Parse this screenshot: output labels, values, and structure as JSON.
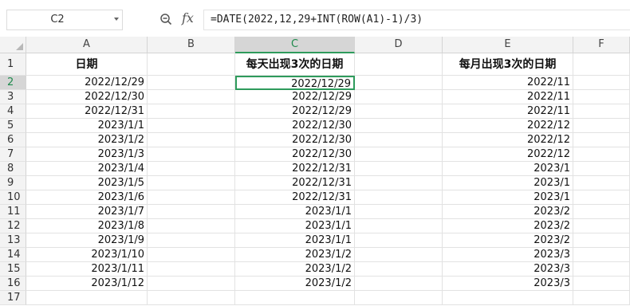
{
  "name_box": "C2",
  "formula": "=DATE(2022,12,29+INT(ROW(A1)-1)/3)",
  "columns": [
    "A",
    "B",
    "C",
    "D",
    "E",
    "F"
  ],
  "rows": [
    "1",
    "2",
    "3",
    "4",
    "5",
    "6",
    "7",
    "8",
    "9",
    "10",
    "11",
    "12",
    "13",
    "14",
    "15",
    "16",
    "17"
  ],
  "headers": {
    "A": "日期",
    "B": "",
    "C": "每天出现3次的日期",
    "D": "",
    "E": "每月出现3次的日期",
    "F": ""
  },
  "colA": [
    "2022/12/29",
    "2022/12/30",
    "2022/12/31",
    "2023/1/1",
    "2023/1/2",
    "2023/1/3",
    "2023/1/4",
    "2023/1/5",
    "2023/1/6",
    "2023/1/7",
    "2023/1/8",
    "2023/1/9",
    "2023/1/10",
    "2023/1/11",
    "2023/1/12"
  ],
  "colC": [
    "2022/12/29",
    "2022/12/29",
    "2022/12/29",
    "2022/12/30",
    "2022/12/30",
    "2022/12/30",
    "2022/12/31",
    "2022/12/31",
    "2022/12/31",
    "2023/1/1",
    "2023/1/1",
    "2023/1/1",
    "2023/1/2",
    "2023/1/2",
    "2023/1/2"
  ],
  "colE": [
    "2022/11",
    "2022/11",
    "2022/11",
    "2022/12",
    "2022/12",
    "2022/12",
    "2023/1",
    "2023/1",
    "2023/1",
    "2023/2",
    "2023/2",
    "2023/2",
    "2023/3",
    "2023/3",
    "2023/3"
  ],
  "active_cell": "C2",
  "accent_color": "#2e9b5c"
}
